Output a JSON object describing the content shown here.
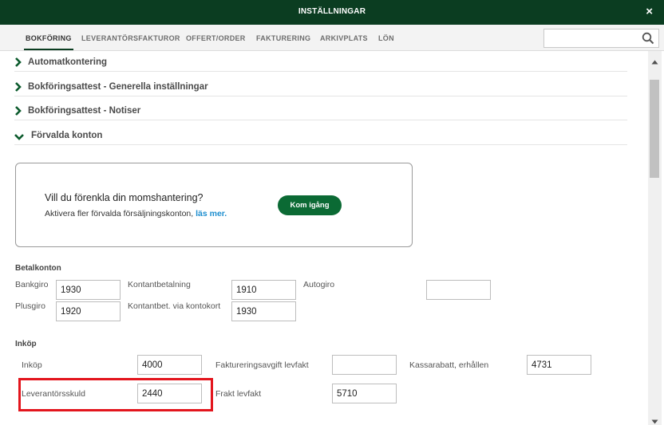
{
  "window": {
    "title": "INSTÄLLNINGAR",
    "close_glyph": "×"
  },
  "tabs": [
    {
      "label": "BOKFÖRING",
      "active": true
    },
    {
      "label": "LEVERANTÖRSFAKTUROR"
    },
    {
      "label": "OFFERT/ORDER"
    },
    {
      "label": "FAKTURERING"
    },
    {
      "label": "ARKIVPLATS"
    },
    {
      "label": "LÖN"
    }
  ],
  "search": {
    "value": "",
    "placeholder": "",
    "icon": "search-icon"
  },
  "accordion": [
    {
      "label": "Automatkontering",
      "expanded": false
    },
    {
      "label": "Bokföringsattest - Generella inställningar",
      "expanded": false
    },
    {
      "label": "Bokföringsattest - Notiser",
      "expanded": false
    },
    {
      "label": "Förvalda konton",
      "expanded": true
    }
  ],
  "promo": {
    "title": "Vill du förenkla din momshantering?",
    "text": "Aktivera fler förvalda försäljningskonton,",
    "link": "läs mer.",
    "button": "Kom igång"
  },
  "betalkonton": {
    "heading": "Betalkonton",
    "fields": {
      "bankgiro": {
        "label": "Bankgiro",
        "value": "1930"
      },
      "kontantbetalning": {
        "label": "Kontantbetalning",
        "value": "1910"
      },
      "autogiro": {
        "label": "Autogiro",
        "value": ""
      },
      "plusgiro": {
        "label": "Plusgiro",
        "value": "1920"
      },
      "kontantbet_kontokort": {
        "label": "Kontantbet. via kontokort",
        "value": "1930"
      }
    }
  },
  "inkop": {
    "heading": "Inköp",
    "fields": {
      "inkop": {
        "label": "Inköp",
        "value": "4000"
      },
      "faktureringsavgift": {
        "label": "Faktureringsavgift levfakt",
        "value": ""
      },
      "kassarabatt": {
        "label": "Kassarabatt, erhållen",
        "value": "4731"
      },
      "leverantorsskuld": {
        "label": "Leverantörsskuld",
        "value": "2440"
      },
      "frakt": {
        "label": "Frakt levfakt",
        "value": "5710"
      }
    }
  },
  "colors": {
    "header": "#0b3d21",
    "button": "#0b6a34",
    "link": "#1d8ecf",
    "highlight": "#e3151d"
  }
}
